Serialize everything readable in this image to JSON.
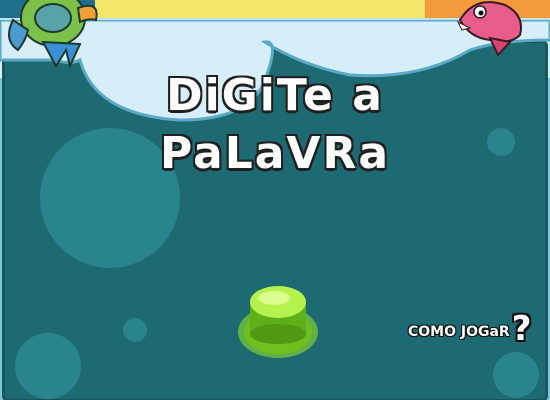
{
  "title": {
    "line1": "DiGiTe a",
    "line2": "PaLaVRa"
  },
  "help": {
    "label": "COMO JOGaR",
    "mark": "?"
  },
  "colors": {
    "panel": "#1d6a72",
    "button": "#8ee02a",
    "title_text": "#ffffff"
  },
  "icons": {
    "left_fish": "green-fish-icon",
    "right_fish": "pink-fish-icon",
    "button": "green-push-button"
  }
}
